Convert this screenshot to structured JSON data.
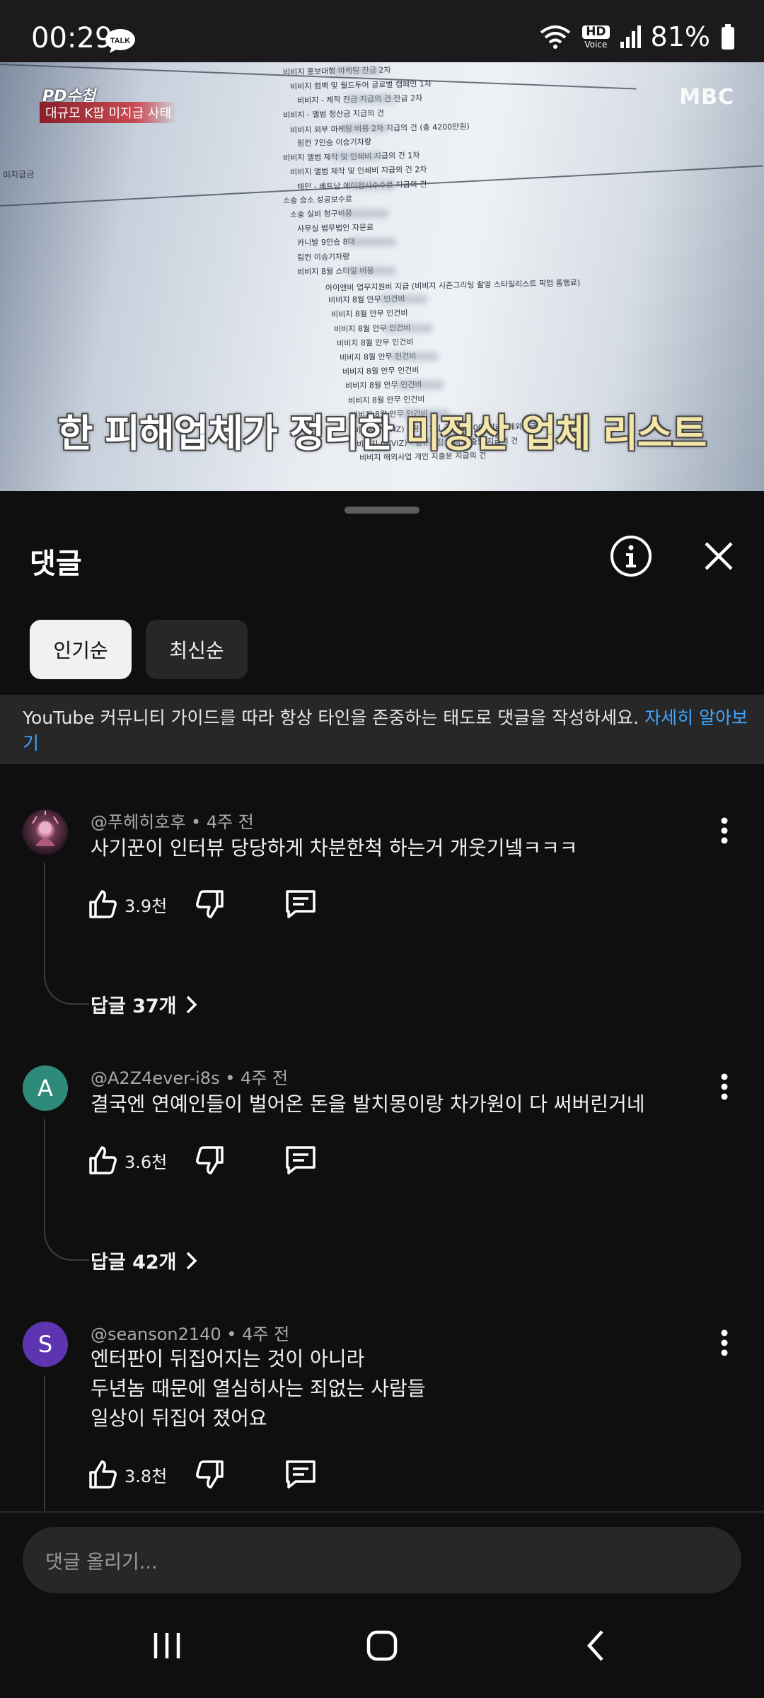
{
  "status_bar": {
    "time": "00:29",
    "talk_badge": "TALK",
    "hd_badge": "HD",
    "hd_sub": "Voice",
    "battery_percent": "81%"
  },
  "video": {
    "program_logo": "PD수첩",
    "program_subtitle": "대규모 K팝 미지급 사태",
    "channel_logo": "MBC",
    "caption_main": "한 피해업체가 정리한 ",
    "caption_highlight": "미정산 업체 리스트",
    "progress_fraction": 0.92,
    "document_lines": [
      "비비지 홍보대행 마케팅 잔금 2차",
      "비비지 컴백 및 월드투어 글로벌 캠페인 1차",
      "비비지 -          제작 잔금 지급의 건          잔금 2차",
      "비비지 -          앨범 정산금 지급의 건",
      "비비지          외부 마케팅 비용 2차 지급의 건 (총 4200만원)",
      "림컨 7인승          이승기차량",
      "비비지          앨범 제작 및 인쇄비 지급의 건 1차",
      "비비지          앨범 제작 및 인쇄비 지급의 건 2차",
      "태민 -          베트남 에이전시수수료 지급의 건",
      "소송 승소 성공보수료",
      "소송 실비 청구비용",
      "사무실 법무법인 자문료",
      "카니발 9인승 8대",
      "림컨          이승기차량",
      "비비지 8월 스타일 비용",
      "아이앤비 업무지원비 지급 (비비지 시즌그리팅 촬영 스타일리스트 픽업 통행료)",
      "비비지 8월 안무 인건비",
      "비비지 8월 안무 인건비",
      "비비지 8월 안무 인건비",
      "비비지 8월 안무 인건비",
      "비비지 8월 안무 인건비",
      "비비지 8월 안무 인건비",
      "비비지 8월 안무 인건비",
      "비비지 8월 안무 인건비",
      "비비지 8월 안무 인건비",
      "비비지 (VIVIZ) - 정규 1집          국비(10,000달러) 해외송금",
      "비비지 (VIVIZ) - 정규 1집          국비 지출분 지급의 건",
      "비비지          해외사업 개인 지출분 지급의 건"
    ],
    "side_label": "미지급금"
  },
  "sheet": {
    "title": "댓글",
    "sort_chips": [
      "인기순",
      "최신순"
    ],
    "guideline_text": "YouTube 커뮤니티 가이드를 따라 항상 타인을 존중하는 태도로 댓글을 작성하세요.",
    "guideline_link": "자세히 알아보기"
  },
  "comments": [
    {
      "author": "@푸헤히호후",
      "time": "4주 전",
      "text": "사기꾼이 인터뷰 당당하게 차분한척 하는거 개웃기넼ㅋㅋㅋ",
      "likes": "3.9천",
      "replies": "답글 37개",
      "avatar_letter": "",
      "avatar_color": "#3a2430"
    },
    {
      "author": "@A2Z4ever-i8s",
      "time": "4주 전",
      "text": "결국엔 연예인들이 벌어온 돈을 발치몽이랑 차가원이 다 써버린거네",
      "likes": "3.6천",
      "replies": "답글 42개",
      "avatar_letter": "A",
      "avatar_color": "#2e8b7a"
    },
    {
      "author": "@seanson2140",
      "time": "4주 전",
      "text_lines": [
        "엔터판이 뒤집어지는 것이  아니라",
        "두년놈 때문에 열심히사는  죄없는  사람들",
        "일상이 뒤집어 졌어요"
      ],
      "likes": "3.8천",
      "avatar_letter": "S",
      "avatar_color": "#5e35b1"
    }
  ],
  "composer": {
    "placeholder": "댓글 올리기..."
  },
  "icons": {
    "info": "info-icon",
    "close": "close-icon",
    "like": "thumbs-up-icon",
    "dislike": "thumbs-down-icon",
    "reply": "reply-icon",
    "more": "more-vert-icon",
    "chevron": "chevron-right-icon",
    "nav_recents": "recents-icon",
    "nav_home": "home-icon",
    "nav_back": "back-icon"
  }
}
